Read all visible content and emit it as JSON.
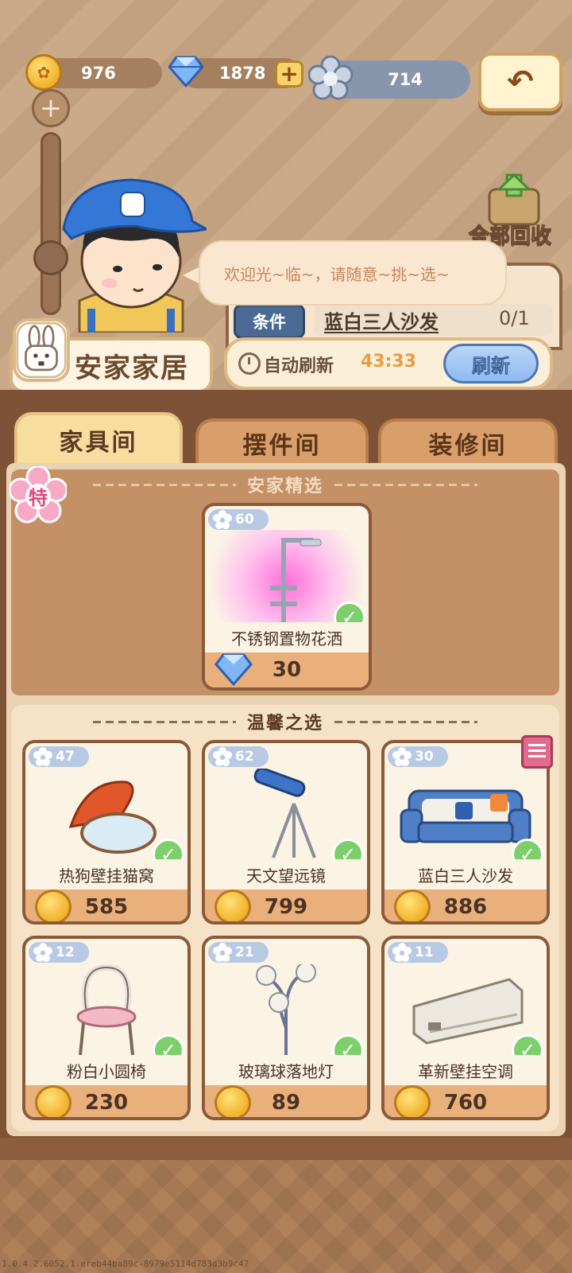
{
  "currencies": {
    "coins": "976",
    "gems": "1878",
    "flowers": "714"
  },
  "recycle_label": "全部回收",
  "speech": "欢迎光~临~，请随意~挑~选~",
  "condition": {
    "tag": "条件",
    "item": "蓝白三人沙发",
    "count": "0/1"
  },
  "refresh": {
    "label": "自动刷新",
    "timer": "43:33",
    "button": "刷新"
  },
  "shop_name": "安家家居",
  "tabs": [
    "家具间",
    "摆件间",
    "装修间"
  ],
  "special_badge": "特",
  "featured": {
    "title": "安家精选",
    "item": {
      "score": "60",
      "name": "不锈钢置物花洒",
      "price": "30",
      "currency": "gem"
    }
  },
  "warm": {
    "title": "温馨之选",
    "items": [
      {
        "score": "47",
        "name": "热狗壁挂猫窝",
        "price": "585"
      },
      {
        "score": "62",
        "name": "天文望远镜",
        "price": "799"
      },
      {
        "score": "30",
        "name": "蓝白三人沙发",
        "price": "886"
      },
      {
        "score": "12",
        "name": "粉白小圆椅",
        "price": "230"
      },
      {
        "score": "21",
        "name": "玻璃球落地灯",
        "price": "89"
      },
      {
        "score": "11",
        "name": "革新壁挂空调",
        "price": "760"
      }
    ]
  },
  "version": "1.0.4.2.6052.1.ereb44ba89c-8979e5114d783d3b9c47",
  "colors": {
    "wood": "#7d5236",
    "panel": "#ead3b3",
    "price_bar": "#eab07b",
    "check": "#7ccf6a",
    "refresh_button": "#8fbaf0"
  }
}
